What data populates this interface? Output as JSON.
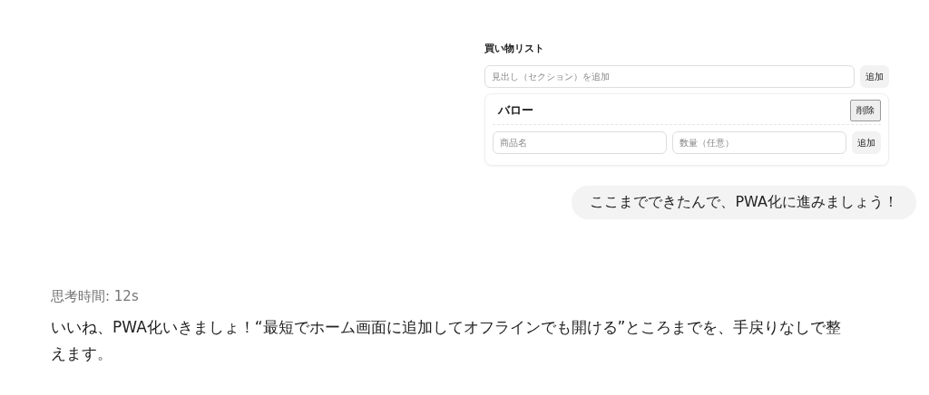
{
  "attachment": {
    "title": "買い物リスト",
    "section_field": {
      "placeholder": "見出し（セクション）を追加"
    },
    "section_add_button": "追加",
    "sections": [
      {
        "heading": "バロー",
        "delete_button": "削除",
        "item_field": {
          "placeholder": "商品名"
        },
        "quantity_field": {
          "placeholder": "数量（任意）"
        },
        "add_button": "追加"
      }
    ]
  },
  "user_message": "ここまでできたんで、PWA化に進みましょう！",
  "thinking_time": "思考時間: 12s",
  "assistant_message": "いいね、PWA化いきましょ！“最短でホーム画面に追加してオフラインでも開ける”ところまでを、手戻りなしで整えます。"
}
